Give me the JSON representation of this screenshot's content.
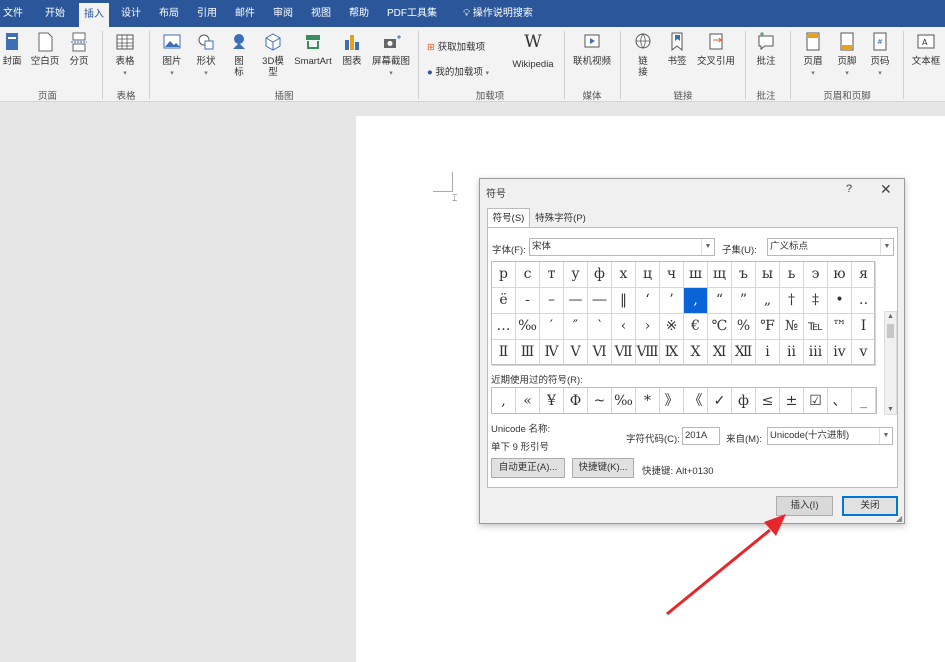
{
  "tabs": [
    "文件",
    "开始",
    "插入",
    "设计",
    "布局",
    "引用",
    "邮件",
    "审阅",
    "视图",
    "帮助",
    "PDF工具集",
    "操作说明搜索"
  ],
  "ribbon": {
    "groups": {
      "pages": {
        "label": "页面",
        "items": [
          "封面",
          "空白页",
          "分页"
        ]
      },
      "tables": {
        "label": "表格",
        "items": [
          "表格"
        ]
      },
      "illustrations": {
        "label": "插图",
        "items": [
          "图片",
          "形状",
          "图标",
          "3D模型",
          "SmartArt",
          "图表",
          "屏幕截图"
        ]
      },
      "addins": {
        "label": "加载项",
        "items": [
          "获取加载项",
          "我的加载项",
          "Wikipedia"
        ]
      },
      "media": {
        "label": "媒体",
        "items": [
          "联机视频"
        ]
      },
      "links": {
        "label": "链接",
        "items": [
          "链接",
          "书签",
          "交叉引用"
        ]
      },
      "comments": {
        "label": "批注",
        "items": [
          "批注"
        ]
      },
      "headerfooter": {
        "label": "页眉和页脚",
        "items": [
          "页眉",
          "页脚",
          "页码"
        ]
      },
      "text": {
        "items": [
          "文本框"
        ]
      }
    }
  },
  "dialog": {
    "title": "符号",
    "help": "?",
    "close": "✕",
    "tabs": [
      "符号(S)",
      "特殊字符(P)"
    ],
    "font_label": "字体(F):",
    "font_value": "宋体",
    "subset_label": "子集(U):",
    "subset_value": "广义标点",
    "symbols": [
      "р",
      "с",
      "т",
      "у",
      "ф",
      "х",
      "ц",
      "ч",
      "ш",
      "щ",
      "ъ",
      "ы",
      "ь",
      "э",
      "ю",
      "я",
      "ё",
      "‐",
      "–",
      "—",
      "―",
      "‖",
      "‘",
      "’",
      "‚",
      "“",
      "”",
      "„",
      "†",
      "‡",
      "•",
      "‥",
      "…",
      "‰",
      "′",
      "″",
      "‵",
      "‹",
      "›",
      "※",
      "€",
      "℃",
      "%",
      "℉",
      "№",
      "℡",
      "™",
      "Ⅰ",
      "Ⅱ",
      "Ⅲ",
      "Ⅳ",
      "Ⅴ",
      "Ⅵ",
      "Ⅶ",
      "Ⅷ",
      "Ⅸ",
      "Ⅹ",
      "Ⅺ",
      "Ⅻ",
      "ⅰ",
      "ⅱ",
      "ⅲ",
      "ⅳ",
      "ⅴ"
    ],
    "selected_index": 24,
    "recent_label": "近期使用过的符号(R):",
    "recent": [
      ",",
      "«",
      "¥",
      "Φ",
      "~",
      "‰",
      "*",
      "》",
      "《",
      "✓",
      "ф",
      "≤",
      "±",
      "☑",
      "、",
      "_"
    ],
    "unicode_name_label": "Unicode 名称:",
    "unicode_name": "单下 9 形引号",
    "char_code_label": "字符代码(C):",
    "char_code": "201A",
    "from_label": "来自(M):",
    "from_value": "Unicode(十六进制)",
    "autocorrect_btn": "自动更正(A)...",
    "shortcut_btn": "快捷键(K)...",
    "shortcut_text": "快捷键: Alt+0130",
    "insert_btn": "插入(I)",
    "close_btn": "关闭"
  },
  "colors": {
    "tabbar": "#2b579a",
    "selected_cell": "#0a64d8",
    "arrow": "#e8262a"
  }
}
